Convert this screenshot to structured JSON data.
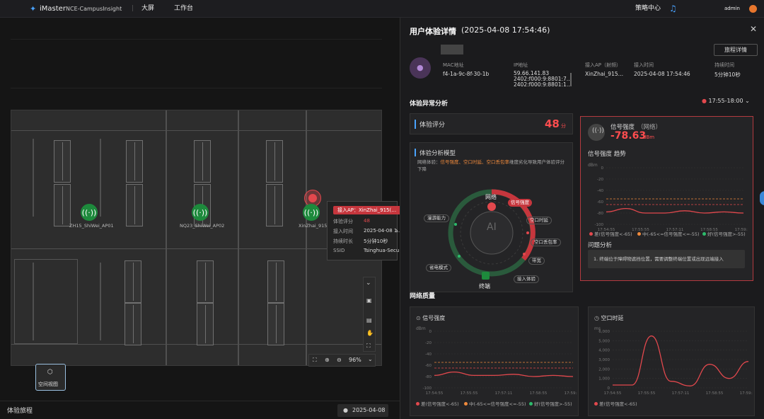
{
  "topbar": {
    "brand": "iMaster",
    "product": "NCE-CampusInsight",
    "nav": [
      "大屏",
      "工作台"
    ],
    "center": "策略中心",
    "user": "admin"
  },
  "map": {
    "aps": [
      {
        "name": "ZH15_ShiWei_AP01"
      },
      {
        "name": "NQ23_ShiWei_AP02"
      },
      {
        "name": "XinZhai_915..."
      }
    ],
    "tooltip": {
      "title": "接入AP：XinZhai_915(…",
      "rows": [
        {
          "k": "体验评分",
          "v": "48"
        },
        {
          "k": "接入时间",
          "v": "2025-04-08 1…"
        },
        {
          "k": "持续时长",
          "v": "5分钟10秒"
        },
        {
          "k": "SSID",
          "v": "Tsinghua-Secu…"
        }
      ]
    },
    "zoom": "96%",
    "view_button": "空间视图",
    "journey_label": "体验旅程",
    "journey_date": "2025-04-08"
  },
  "panel": {
    "title": "用户体验详情",
    "time": "(2025-04-08 17:54:46)",
    "journey_button": "旅程详情",
    "info": [
      {
        "label": "MAC地址",
        "value": "f4-1a-9c-8f-30-1b"
      },
      {
        "label": "IP地址",
        "value": "59.66.141.83\n2402:f000:9:8801:7…\n2402:f000:9:8801:1…"
      },
      {
        "label": "接入AP（射频）",
        "value": "XinZhai_915…"
      },
      {
        "label": "接入时间",
        "value": "2025-04-08 17:54:46"
      },
      {
        "label": "持续时间",
        "value": "5分钟10秒"
      }
    ],
    "anomaly_title": "体验异常分析",
    "time_range": "17:55-18:00",
    "score_label": "体验评分",
    "score_value": "48",
    "score_unit": "分",
    "model_title": "体验分析模型",
    "model_desc_prefix": "网络体验：",
    "model_desc_hl": "信号强度、空口时延、空口丢包率",
    "model_desc_suffix": "维度劣化导致用户体验评分下降",
    "model_nodes": {
      "network": "网络",
      "terminal": "终端",
      "signal": "信号强度",
      "latency": "空口时延",
      "loss": "空口丢包率",
      "bandwidth": "带宽",
      "access": "接入体验",
      "roaming": "漫游能力",
      "power": "省电模式",
      "center": "AI"
    },
    "signal_card": {
      "title": "信号强度",
      "subtitle": "（网络）",
      "value": "-78.63",
      "unit": "dBm",
      "trend_title": "信号强度 趋势",
      "issue_title": "问题分析",
      "issue_text": "1.  终端位于障碍物遮挡位置，需要调整终端位置或出现远端接入"
    },
    "quality_title": "网络质量",
    "chart_titles": [
      "信号强度",
      "空口时延"
    ],
    "legend": [
      {
        "label": "差(信号强度<-65)",
        "color": "#e2484d"
      },
      {
        "label": "中(-65<=信号强度<=-55)",
        "color": "#f08a3c"
      },
      {
        "label": "好(信号强度>-55)",
        "color": "#2dbb6b"
      }
    ]
  },
  "chart_data": [
    {
      "type": "line",
      "title": "信号强度 趋势",
      "ylabel": "dBm",
      "ylim": [
        -100,
        0
      ],
      "yticks": [
        0,
        -20,
        -40,
        -60,
        -80,
        -100
      ],
      "x": [
        "17:54:55",
        "17:55:55",
        "17:57:11",
        "17:58:55",
        "17:59:56"
      ],
      "series": [
        {
          "values": [
            -78,
            -72,
            -80,
            -80,
            -76,
            -80,
            -78,
            -80
          ]
        }
      ],
      "thresholds": [
        -55,
        -65
      ]
    },
    {
      "type": "line",
      "title": "信号强度",
      "ylabel": "dBm",
      "ylim": [
        -100,
        0
      ],
      "yticks": [
        0,
        -20,
        -40,
        -60,
        -80,
        -100
      ],
      "x": [
        "17:54:55",
        "17:55:55",
        "17:57:11",
        "17:58:55",
        "17:59:56"
      ],
      "series": [
        {
          "values": [
            -78,
            -72,
            -78,
            -78,
            -76,
            -80,
            -78,
            -80
          ]
        }
      ],
      "thresholds": [
        -55,
        -65
      ]
    },
    {
      "type": "line",
      "title": "空口时延",
      "ylabel": "ms",
      "ylim": [
        0,
        6000
      ],
      "yticks": [
        0,
        1000,
        2000,
        3000,
        4000,
        5000,
        6000
      ],
      "x": [
        "17:54:55",
        "17:55:55",
        "17:57:11",
        "17:58:55",
        "17:59:56"
      ],
      "series": [
        {
          "values": [
            300,
            300,
            5500,
            700,
            200,
            2500,
            1000,
            2800
          ]
        }
      ]
    }
  ]
}
